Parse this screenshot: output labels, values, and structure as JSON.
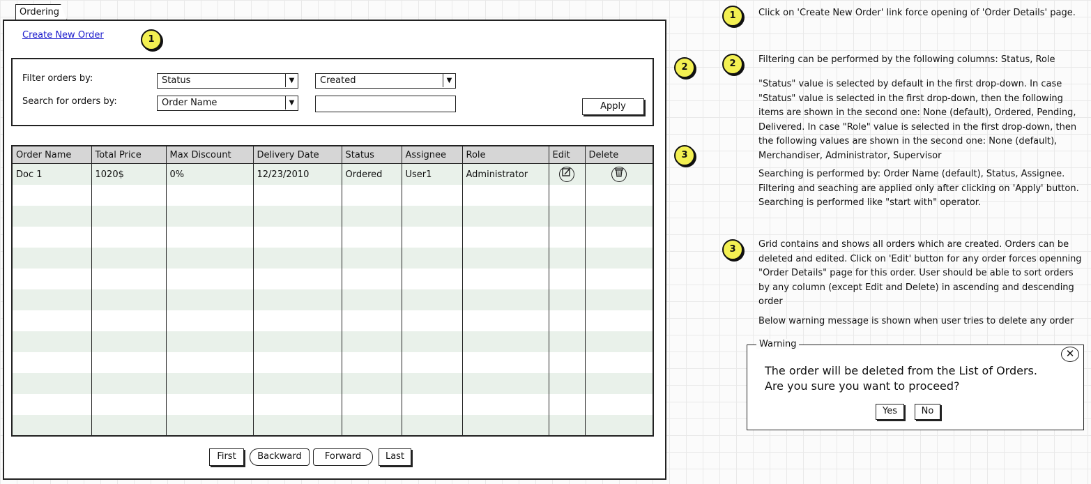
{
  "tab": {
    "label": "Ordering"
  },
  "create_link": "Create New Order",
  "badges": {
    "one": "1",
    "two": "2",
    "three": "3"
  },
  "filter": {
    "filter_label": "Filter orders by:",
    "search_label": "Search for orders by:",
    "filter_field": "Status",
    "filter_value": "Created",
    "search_field": "Order Name",
    "search_value": "",
    "apply_label": "Apply"
  },
  "grid": {
    "columns": [
      "Order Name",
      "Total Price",
      "Max Discount",
      "Delivery Date",
      "Status",
      "Assignee",
      "Role",
      "Edit",
      "Delete"
    ],
    "rows": [
      {
        "order_name": "Doc 1",
        "total_price": "1020$",
        "max_discount": "0%",
        "delivery_date": "12/23/2010",
        "status": "Ordered",
        "assignee": "User1",
        "role": "Administrator"
      }
    ]
  },
  "pager": {
    "first": "First",
    "backward": "Backward",
    "forward": "Forward",
    "last": "Last"
  },
  "notes": {
    "note1": "Click on 'Create New Order' link force opening of 'Order Details' page.",
    "note2a": "Filtering can be performed by the following columns: Status, Role",
    "note2b": "\"Status\" value is selected by default in the first drop-down. In case \"Status\" value is selected in the first drop-down, then the following items are shown in the second one: None (default), Ordered, Pending, Delivered. In case \"Role\" value is selected in the first drop-down, then the following values are shown in the second one: None (default), Merchandiser, Administrator, Supervisor",
    "note2c": "Searching is performed by: Order Name (default), Status, Assignee. Filtering and seaching are applied only after clicking on 'Apply' button. Searching is performed like \"start with\" operator.",
    "note3a": "Grid contains and shows all orders which are created. Orders can be deleted and edited. Click on 'Edit' button for any order forces openning \"Order Details\" page for this order. User should be able to sort orders by any column (except Edit and Delete) in ascending and descending order",
    "note3b": "Below warning message is shown when user tries to delete any order"
  },
  "warning": {
    "title": "Warning",
    "line1": "The order will be deleted from the List of Orders.",
    "line2": "Are you sure you want to proceed?",
    "yes": "Yes",
    "no": "No"
  },
  "icons": {
    "edit": "edit-icon",
    "delete": "trash-icon",
    "close": "close-icon",
    "dropdown": "chevron-down-icon"
  },
  "colors": {
    "badge": "#f3f052",
    "row_alt": "#e9f1ea",
    "header": "#d6d6d6",
    "link": "#1a1acc"
  }
}
